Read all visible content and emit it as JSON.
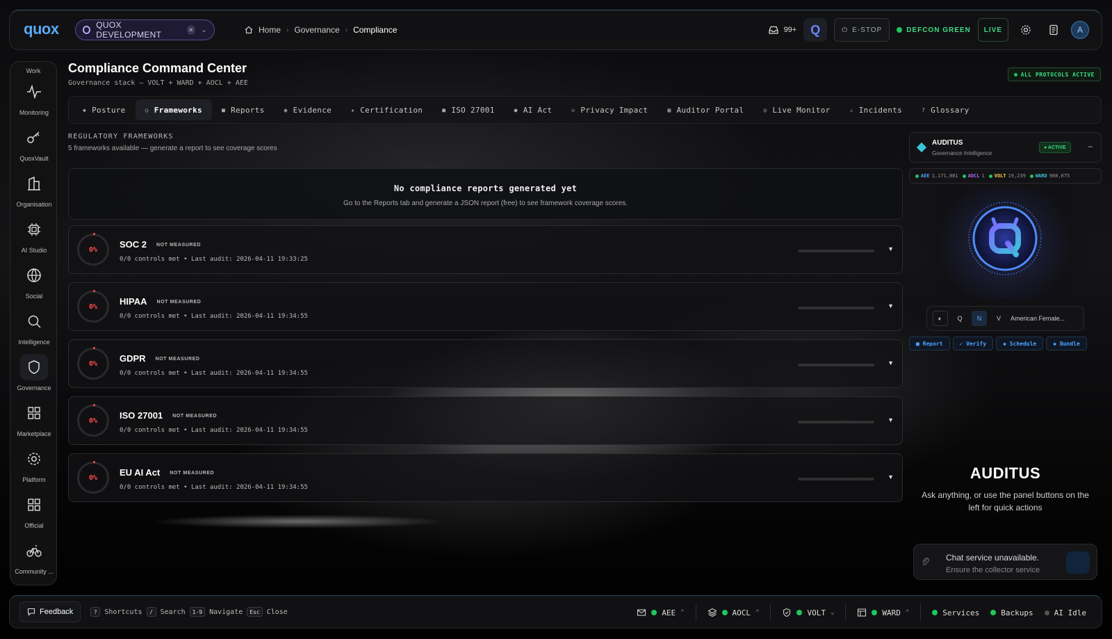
{
  "app": {
    "logo": "quox",
    "environment": "QUOX DEVELOPMENT"
  },
  "breadcrumb": [
    "Home",
    "Governance",
    "Compliance"
  ],
  "topbar": {
    "inbox_count": "99+",
    "estop_label": "E-STOP",
    "defcon_label": "DEFCON GREEN",
    "live_label": "LIVE",
    "avatar_initial": "A"
  },
  "sidebar": {
    "section_label": "Work",
    "items": [
      {
        "label": "Monitoring",
        "icon": "activity-icon"
      },
      {
        "label": "QuoxVault",
        "icon": "key-icon"
      },
      {
        "label": "Organisation",
        "icon": "building-icon"
      },
      {
        "label": "AI Studio",
        "icon": "chip-icon"
      },
      {
        "label": "Social",
        "icon": "globe-icon"
      },
      {
        "label": "Intelligence",
        "icon": "search-icon"
      },
      {
        "label": "Governance",
        "icon": "shield-icon",
        "active": true
      },
      {
        "label": "Marketplace",
        "icon": "grid-icon"
      },
      {
        "label": "Platform",
        "icon": "gear-icon"
      },
      {
        "label": "Official",
        "icon": "grid-icon"
      },
      {
        "label": "Community ...",
        "icon": "bike-icon"
      }
    ]
  },
  "page": {
    "title": "Compliance Command Center",
    "subtitle": "Governance stack — VOLT + WARD + AOCL + AEE",
    "protocols_badge": "ALL PROTOCOLS ACTIVE"
  },
  "tabs": [
    {
      "label": "Posture",
      "icon": "◆"
    },
    {
      "label": "Frameworks",
      "icon": "○",
      "active": true
    },
    {
      "label": "Reports",
      "icon": "■"
    },
    {
      "label": "Evidence",
      "icon": "◉"
    },
    {
      "label": "Certification",
      "icon": "★"
    },
    {
      "label": "ISO 27001",
      "icon": "■"
    },
    {
      "label": "AI Act",
      "icon": "●"
    },
    {
      "label": "Privacy Impact",
      "icon": "◇"
    },
    {
      "label": "Auditor Portal",
      "icon": "▦"
    },
    {
      "label": "Live Monitor",
      "icon": "◎"
    },
    {
      "label": "Incidents",
      "icon": "⚠"
    },
    {
      "label": "Glossary",
      "icon": "?"
    }
  ],
  "frameworks_section": {
    "label": "REGULATORY FRAMEWORKS",
    "sub": "5 frameworks available — generate a report to see coverage scores",
    "empty_title": "No compliance reports generated yet",
    "empty_sub": "Go to the Reports tab and generate a JSON report (free) to see framework coverage scores."
  },
  "frameworks": [
    {
      "name": "SOC 2",
      "badge": "NOT MEASURED",
      "pct": "0%",
      "meta": "0/0 controls met • Last audit: 2026-04-11 19:33:25"
    },
    {
      "name": "HIPAA",
      "badge": "NOT MEASURED",
      "pct": "0%",
      "meta": "0/0 controls met • Last audit: 2026-04-11 19:34:55"
    },
    {
      "name": "GDPR",
      "badge": "NOT MEASURED",
      "pct": "0%",
      "meta": "0/0 controls met • Last audit: 2026-04-11 19:34:55"
    },
    {
      "name": "ISO 27001",
      "badge": "NOT MEASURED",
      "pct": "0%",
      "meta": "0/0 controls met • Last audit: 2026-04-11 19:34:55"
    },
    {
      "name": "EU AI Act",
      "badge": "NOT MEASURED",
      "pct": "0%",
      "meta": "0/0 controls met • Last audit: 2026-04-11 19:34:55"
    }
  ],
  "auditus": {
    "name": "AUDITUS",
    "subtitle": "Governance Intelligence",
    "status": "● ACTIVE",
    "stats": [
      {
        "key": "AEE",
        "value": "1,171,881",
        "color": "#4da3ff"
      },
      {
        "key": "AOCL",
        "value": "1",
        "color": "#b06cff"
      },
      {
        "key": "VOLT",
        "value": "19,239",
        "color": "#f5d142"
      },
      {
        "key": "WARD",
        "value": "908,075",
        "color": "#3bc4d9"
      }
    ],
    "voice_modes": [
      "Q",
      "N",
      "V"
    ],
    "voice_name": "American Female...",
    "actions": [
      "■ Report",
      "✓ Verify",
      "◆ Schedule",
      "◆ Bundle"
    ],
    "big_title": "AUDITUS",
    "help_text": "Ask anything, or use the panel buttons on the left for quick actions",
    "chat_status": "Chat service unavailable.",
    "chat_status_2": "Ensure the collector service"
  },
  "bottombar": {
    "feedback_label": "Feedback",
    "shortcuts": [
      {
        "key": "?",
        "label": "Shortcuts"
      },
      {
        "key": "/",
        "label": "Search"
      },
      {
        "key": "1-9",
        "label": "Navigate"
      },
      {
        "key": "Esc",
        "label": "Close"
      }
    ],
    "services": [
      {
        "label": "AEE",
        "icon": "mail-icon",
        "chev": "⌃"
      },
      {
        "label": "AOCL",
        "icon": "layers-icon",
        "chev": "⌃"
      },
      {
        "label": "VOLT",
        "icon": "shield-icon",
        "chev": "⌄"
      },
      {
        "label": "WARD",
        "icon": "table-icon",
        "chev": "⌃"
      }
    ],
    "services_label": "Services",
    "backups_label": "Backups",
    "ai_label": "AI Idle"
  }
}
